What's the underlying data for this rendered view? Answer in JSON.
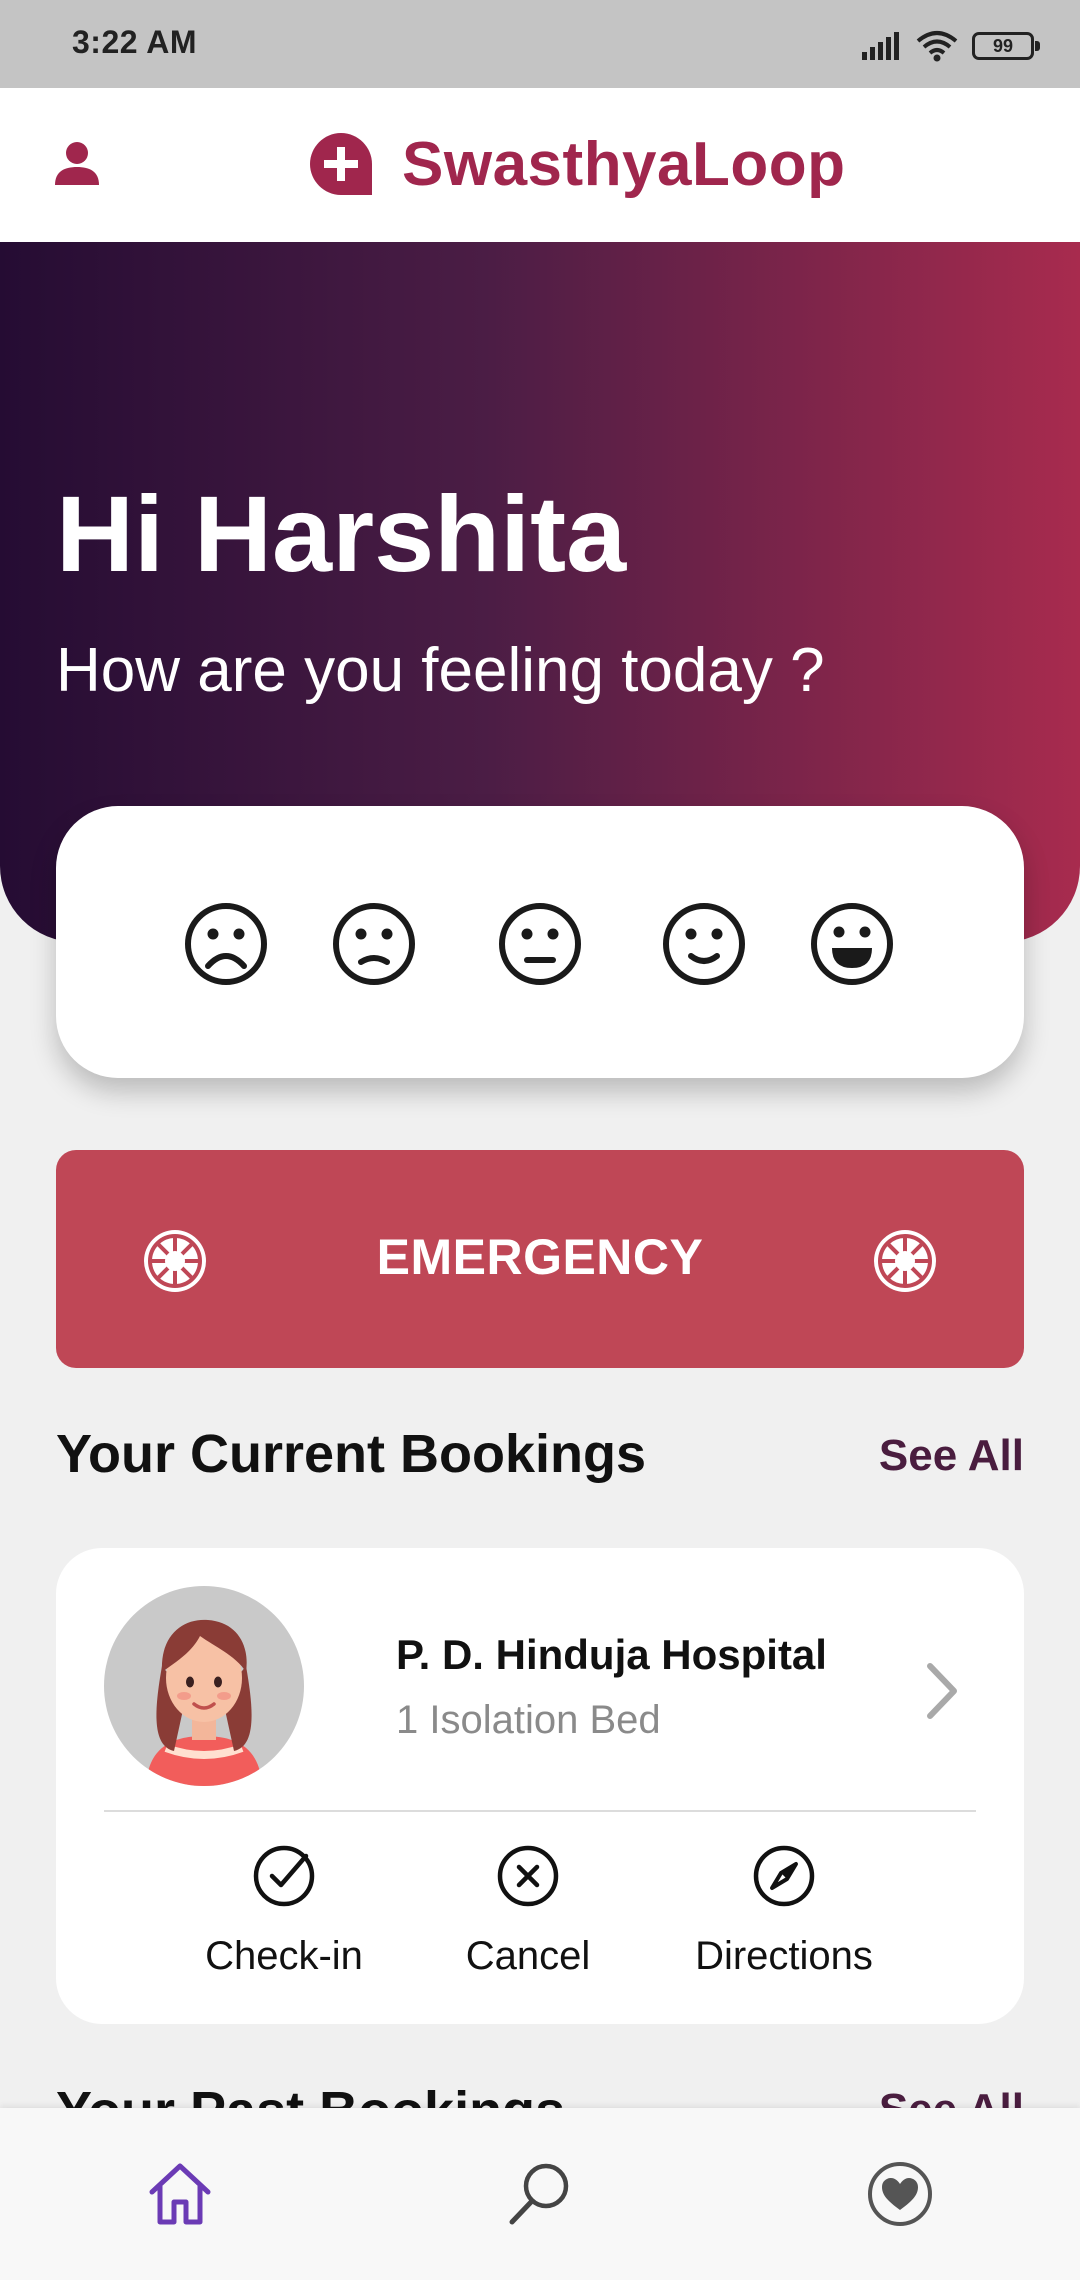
{
  "status_bar": {
    "time": "3:22 AM",
    "battery": "99",
    "icons": [
      "signal-icon",
      "wifi-icon",
      "battery-icon"
    ]
  },
  "app_bar": {
    "title": "SwasthyaLoop",
    "brand_color": "#a0264d",
    "icons": [
      "profile-icon",
      "logo-medical-cross-icon"
    ]
  },
  "hero": {
    "greeting": "Hi Harshita",
    "subtitle": "How are you feeling today ?",
    "gradient": [
      "#250c33",
      "#4b1d45",
      "#a82b4e"
    ]
  },
  "mood_options": [
    "very-sad-face-icon",
    "sad-face-icon",
    "neutral-face-icon",
    "smiling-face-icon",
    "very-happy-face-icon"
  ],
  "emergency": {
    "label": "EMERGENCY",
    "color": "#bf4756",
    "icon": "sos-emblem-icon"
  },
  "current_bookings": {
    "title": "Your Current Bookings",
    "see_all": "See All",
    "items": [
      {
        "hospital": "P. D. Hinduja Hospital",
        "detail": "1 Isolation Bed",
        "actions": [
          {
            "label": "Check-in",
            "icon": "check-circle-icon"
          },
          {
            "label": "Cancel",
            "icon": "cancel-circle-icon"
          },
          {
            "label": "Directions",
            "icon": "compass-icon"
          }
        ]
      }
    ]
  },
  "past_bookings": {
    "title": "Your Past Bookings",
    "see_all": "See All"
  },
  "bottom_nav": {
    "items": [
      "home-icon",
      "search-icon",
      "favorites-heart-icon"
    ],
    "active_color": "#6b3bb5"
  }
}
